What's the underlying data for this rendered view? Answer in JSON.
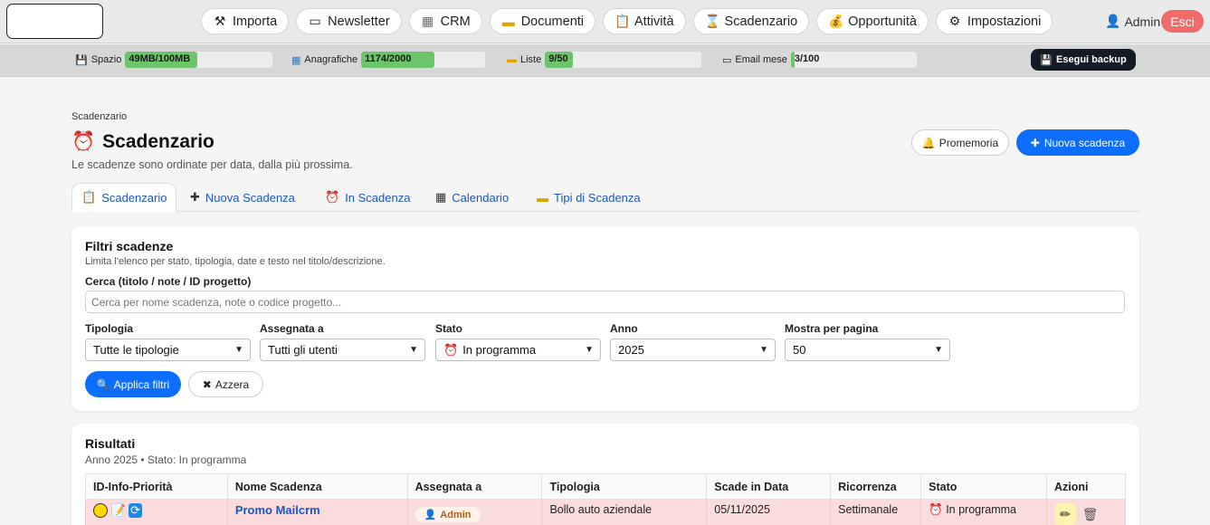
{
  "nav": [
    {
      "label": "Importa",
      "icon": "tools-icon"
    },
    {
      "label": "Newsletter",
      "icon": "envelope-icon"
    },
    {
      "label": "CRM",
      "icon": "building-icon"
    },
    {
      "label": "Documenti",
      "icon": "folder-icon"
    },
    {
      "label": "Attività",
      "icon": "clipboard-icon"
    },
    {
      "label": "Scadenzario",
      "icon": "hourglass-icon"
    },
    {
      "label": "Opportunità",
      "icon": "moneybag-icon"
    },
    {
      "label": "Impostazioni",
      "icon": "gear-icon"
    }
  ],
  "user": {
    "name": "Admin",
    "logout": "Esci"
  },
  "quota": [
    {
      "label": "Spazio",
      "value": "49MB/100MB",
      "fraction": 0.49
    },
    {
      "label": "Anagrafiche",
      "value": "1174/2000",
      "fraction": 0.587
    },
    {
      "label": "Liste",
      "value": "9/50",
      "fraction": 0.18
    },
    {
      "label": "Email mese",
      "value": "3/100",
      "fraction": 0.03
    }
  ],
  "backup_label": "Esegui backup",
  "breadcrumb": "Scadenzario",
  "page": {
    "title": "Scadenzario",
    "subtitle": "Le scadenze sono ordinate per data, dalla più prossima.",
    "btn_reminder": "Promemoria",
    "btn_new": "Nuova scadenza"
  },
  "tabs": [
    {
      "label": "Scadenzario",
      "icon": "clipboard-icon"
    },
    {
      "label": "Nuova Scadenza",
      "icon": "plus-icon"
    },
    {
      "label": "In Scadenza",
      "icon": "alarm-clock-icon"
    },
    {
      "label": "Calendario",
      "icon": "calendar-icon"
    },
    {
      "label": "Tipi di Scadenza",
      "icon": "folder-icon"
    }
  ],
  "filters": {
    "title": "Filtri scadenze",
    "subtitle": "Limita l'elenco per stato, tipologia, date e testo nel titolo/descrizione.",
    "search_label": "Cerca (titolo / note / ID progetto)",
    "search_placeholder": "Cerca per nome scadenza, note o codice progetto...",
    "tipologia_label": "Tipologia",
    "tipologia_value": "Tutte le tipologie",
    "assegnata_label": "Assegnata a",
    "assegnata_value": "Tutti gli utenti",
    "stato_label": "Stato",
    "stato_value": "In programma",
    "anno_label": "Anno",
    "anno_value": "2025",
    "per_page_label": "Mostra per pagina",
    "per_page_value": "50",
    "apply": "Applica filtri",
    "reset": "Azzera"
  },
  "results": {
    "title": "Risultati",
    "subtitle": "Anno 2025 • Stato: In programma",
    "columns": [
      "ID-Info-Priorità",
      "Nome Scadenza",
      "Assegnata a",
      "Tipologia",
      "Scade in Data",
      "Ricorrenza",
      "Stato",
      "Azioni"
    ],
    "rows": [
      {
        "name": "Promo Mailcrm",
        "assigned": "Admin",
        "type": "Bollo auto aziendale",
        "due": "05/11/2025",
        "recurrence": "Settimanale",
        "status": "In programma"
      }
    ]
  }
}
